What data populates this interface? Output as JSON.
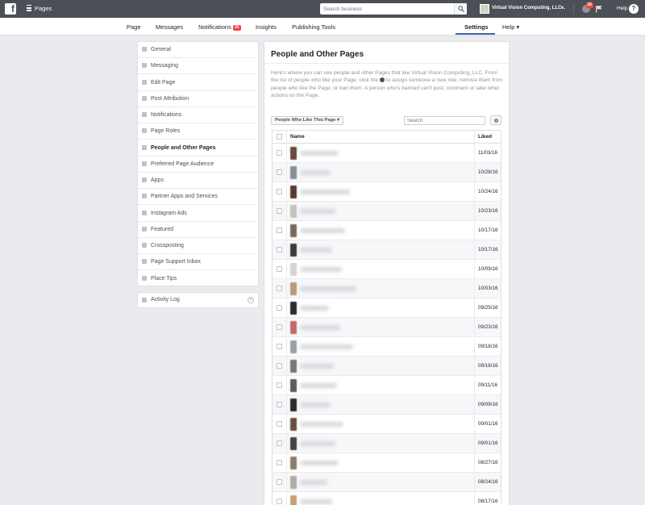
{
  "topbar": {
    "logo": "f",
    "title": "Pages",
    "search_placeholder": "Search business",
    "account_name": "Virtual Vision Computing, LLC",
    "account_ellipsis": "...",
    "globe_badge": "26",
    "help": "Help"
  },
  "subnav": {
    "page": "Page",
    "messages": "Messages",
    "notifications": "Notifications",
    "notifications_count": "20",
    "insights": "Insights",
    "publishing_tools": "Publishing Tools",
    "settings": "Settings",
    "help": "Help ▾"
  },
  "sidebar": {
    "items": [
      {
        "label": "General",
        "icon": "gear-icon"
      },
      {
        "label": "Messaging",
        "icon": "chat-icon"
      },
      {
        "label": "Edit Page",
        "icon": "pencil-icon"
      },
      {
        "label": "Post Attribution",
        "icon": "flag-icon"
      },
      {
        "label": "Notifications",
        "icon": "globe-icon"
      },
      {
        "label": "Page Roles",
        "icon": "person-icon"
      },
      {
        "label": "People and Other Pages",
        "icon": "people-icon",
        "active": true
      },
      {
        "label": "Preferred Page Audience",
        "icon": "audience-icon"
      },
      {
        "label": "Apps",
        "icon": "apps-icon"
      },
      {
        "label": "Partner Apps and Services",
        "icon": "partner-icon"
      },
      {
        "label": "Instagram Ads",
        "icon": "instagram-icon"
      },
      {
        "label": "Featured",
        "icon": "star-icon"
      },
      {
        "label": "Crossposting",
        "icon": "video-icon"
      },
      {
        "label": "Page Support Inbox",
        "icon": "inbox-icon"
      },
      {
        "label": "Place Tips",
        "icon": "place-icon"
      }
    ],
    "activity_log": "Activity Log"
  },
  "main": {
    "title": "People and Other Pages",
    "desc_1": "Here's where you can see people and other Pages that like Virtual Vision Computing, LLC. From the list of people who like your Page, click the",
    "desc_2": "to assign someone a new role, remove them from people who like the Page, or ban them. A person who's banned can't post, comment or take other actions on the Page.",
    "filter_label": "People Who Like This Page ▾",
    "search_placeholder": "Search",
    "col_name": "Name",
    "col_liked": "Liked",
    "rows": [
      {
        "liked": "11/03/16"
      },
      {
        "liked": "10/28/16"
      },
      {
        "liked": "10/24/16"
      },
      {
        "liked": "10/23/16"
      },
      {
        "liked": "10/17/16"
      },
      {
        "liked": "10/17/16"
      },
      {
        "liked": "10/09/16"
      },
      {
        "liked": "10/03/16"
      },
      {
        "liked": "09/25/16"
      },
      {
        "liked": "09/23/16"
      },
      {
        "liked": "09/18/16"
      },
      {
        "liked": "09/16/16"
      },
      {
        "liked": "09/11/16"
      },
      {
        "liked": "09/09/16"
      },
      {
        "liked": "09/01/16"
      },
      {
        "liked": "09/01/16"
      },
      {
        "liked": "08/27/16"
      },
      {
        "liked": "08/24/16"
      },
      {
        "liked": "08/17/16"
      }
    ]
  },
  "colors": {
    "topbar": "#4b4f56",
    "accent": "#4267b2",
    "badge": "#fa3e3e",
    "background": "#e9ebee"
  }
}
